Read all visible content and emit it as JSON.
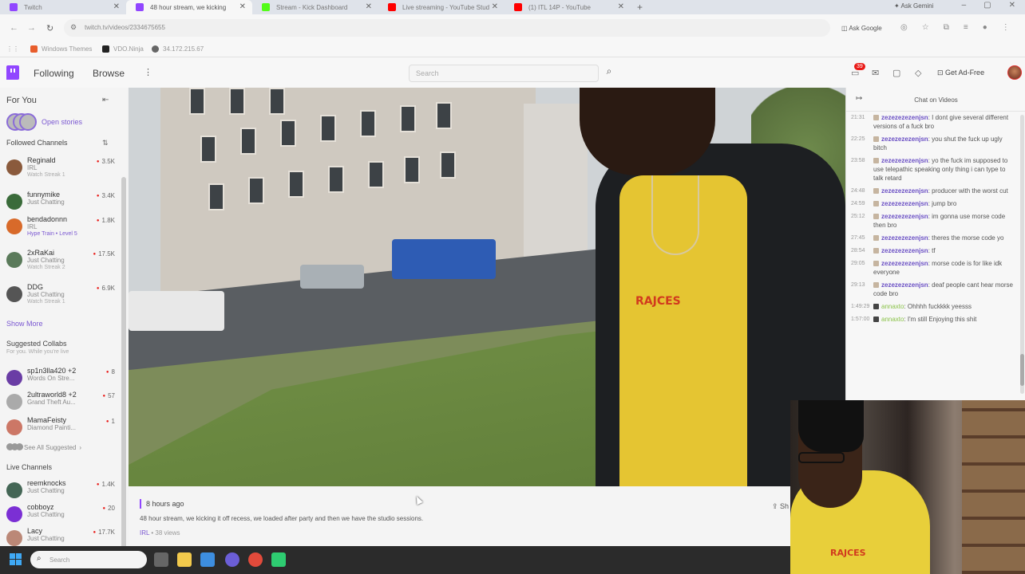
{
  "browser": {
    "tabs": [
      {
        "title": "Twitch",
        "color": "#9146ff",
        "active": false
      },
      {
        "title": "48 hour stream, we kicking",
        "color": "#9146ff",
        "active": true
      },
      {
        "title": "Stream - Kick Dashboard",
        "color": "#53fc18",
        "active": false
      },
      {
        "title": "Live streaming - YouTube Stud",
        "color": "#ff0000",
        "active": false
      },
      {
        "title": "(1) ITL 14P - YouTube",
        "color": "#ff0000",
        "active": false
      }
    ],
    "new_tab": "+",
    "ask_gemini": "Ask Gemini",
    "window_buttons": [
      "–",
      "▢",
      "✕"
    ],
    "url": "twitch.tv/videos/2334675655",
    "ask_google": "Ask Google",
    "bookmarks": [
      {
        "label": "Windows Themes",
        "color": "#e85d2c"
      },
      {
        "label": "VDO.Ninja",
        "color": "#222"
      },
      {
        "label": "34.172.215.67",
        "color": "#666"
      }
    ]
  },
  "twitch_nav": {
    "following": "Following",
    "browse": "Browse",
    "more": "⋮",
    "search_placeholder": "Search",
    "notif_count": "39",
    "get_ad_free": "Get Ad-Free"
  },
  "sidebar": {
    "for_you": "For You",
    "open_stories": "Open stories",
    "followed_header": "Followed Channels",
    "followed": [
      {
        "name": "Reginald",
        "category": "IRL",
        "sub": "Watch Streak 1",
        "viewers": "3.5K",
        "color": "#8a5a3c"
      },
      {
        "name": "funnymike",
        "category": "Just Chatting",
        "sub": "",
        "viewers": "3.4K",
        "color": "#3a6b3a"
      },
      {
        "name": "bendadonnn",
        "category": "IRL",
        "sub": "Hype Train • Level 5",
        "viewers": "1.8K",
        "color": "#d86a2a"
      },
      {
        "name": "2xRaKai",
        "category": "Just Chatting",
        "sub": "Watch Streak 2",
        "viewers": "17.5K",
        "color": "#5a7a5a"
      },
      {
        "name": "DDG",
        "category": "Just Chatting",
        "sub": "Watch Streak 1",
        "viewers": "6.9K",
        "color": "#555"
      }
    ],
    "show_more": "Show More",
    "suggested_header": "Suggested Collabs",
    "suggested_sub": "For you. While you're live",
    "suggested": [
      {
        "name": "sp1n3lla420 +2",
        "category": "Words On Stre...",
        "viewers": "8",
        "color": "#6a3da5"
      },
      {
        "name": "2ultraworld8 +2",
        "category": "Grand Theft Au...",
        "viewers": "57",
        "color": "#aaa"
      },
      {
        "name": "MamaFeisty",
        "category": "Diamond Painti...",
        "viewers": "1",
        "color": "#c76"
      }
    ],
    "see_all": "See All Suggested",
    "live_header": "Live Channels",
    "live": [
      {
        "name": "reemknocks",
        "category": "Just Chatting",
        "viewers": "1.4K",
        "color": "#465"
      },
      {
        "name": "cobboyz",
        "category": "Just Chatting",
        "viewers": "20",
        "color": "#7b2fd4"
      },
      {
        "name": "Lacy",
        "category": "Just Chatting",
        "viewers": "17.7K",
        "color": "#b87"
      }
    ]
  },
  "video": {
    "ago": "8 hours ago",
    "title": "48 hour stream, we kicking it off recess, we loaded after party and then we have the studio sessions.",
    "category": "IRL",
    "views": "38 views",
    "share": "Sh",
    "shirt_text": "RAJCES"
  },
  "chat": {
    "title": "Chat on Videos",
    "messages": [
      {
        "time": "21:31",
        "user": "zezezezezenjsn",
        "text": ": I dont give several different versions of a fuck bro",
        "badge": "light",
        "green": false
      },
      {
        "time": "22:25",
        "user": "zezezezezenjsn",
        "text": ": you shut the fuck up ugly bitch",
        "badge": "light",
        "green": false
      },
      {
        "time": "23:58",
        "user": "zezezezezenjsn",
        "text": ": yo the fuck im supposed to use telepathic speaking only thing i can type to talk retard",
        "badge": "light",
        "green": false
      },
      {
        "time": "24:48",
        "user": "zezezezezenjsn",
        "text": ": producer with the worst cut",
        "badge": "light",
        "green": false
      },
      {
        "time": "24:59",
        "user": "zezezezezenjsn",
        "text": ": jump bro",
        "badge": "light",
        "green": false
      },
      {
        "time": "25:12",
        "user": "zezezezezenjsn",
        "text": ": im gonna use morse code then bro",
        "badge": "light",
        "green": false
      },
      {
        "time": "27:45",
        "user": "zezezezezenjsn",
        "text": ": theres the morse code yo",
        "badge": "light",
        "green": false
      },
      {
        "time": "28:54",
        "user": "zezezezezenjsn",
        "text": ": tf",
        "badge": "light",
        "green": false
      },
      {
        "time": "29:05",
        "user": "zezezezezenjsn",
        "text": ": morse code is for like idk everyone",
        "badge": "light",
        "green": false
      },
      {
        "time": "29:13",
        "user": "zezezezezenjsn",
        "text": ": deaf people cant hear morse code bro",
        "badge": "light",
        "green": false
      },
      {
        "time": "1:49:29",
        "user": "annaxto",
        "text": ": Ohhhh fuckkkk yeesss",
        "badge": "dark",
        "green": true
      },
      {
        "time": "1:57:00",
        "user": "annaxto",
        "text": ": I'm still Enjoying this shit",
        "badge": "dark",
        "green": true
      }
    ]
  },
  "taskbar": {
    "search_placeholder": "Search",
    "apps": [
      {
        "name": "task-view",
        "color": "#666"
      },
      {
        "name": "file-explorer",
        "color": "#f2c94c"
      },
      {
        "name": "store",
        "color": "#3d8ee0"
      },
      {
        "name": "obs",
        "color": "#6b5ed6"
      },
      {
        "name": "chrome",
        "color": "#e24a3b"
      },
      {
        "name": "kick-app",
        "color": "#2ecc71"
      }
    ]
  }
}
